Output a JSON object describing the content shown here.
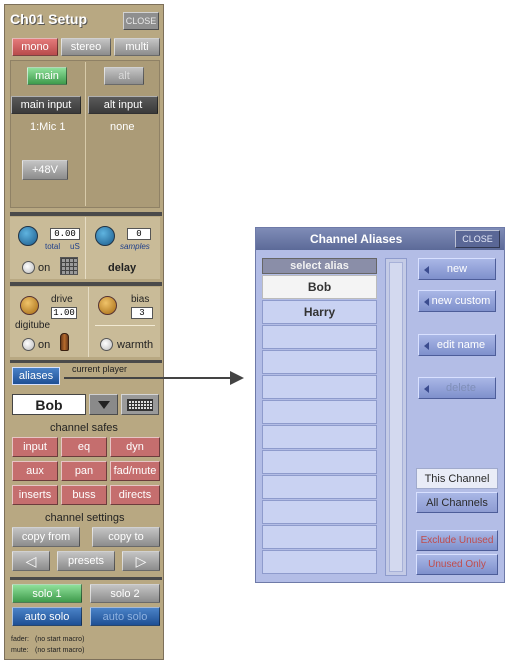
{
  "setup": {
    "title": "Ch01 Setup",
    "close": "CLOSE",
    "modes": [
      "mono",
      "stereo",
      "multi"
    ],
    "main_btn": "main",
    "alt_btn": "alt",
    "main_input_btn": "main input",
    "alt_input_btn": "alt input",
    "main_input_value": "1:Mic 1",
    "alt_input_value": "none",
    "phantom": "+48V",
    "delay": {
      "total_value": "0.00",
      "total_label": "total",
      "total_unit": "uS",
      "samples_value": "0",
      "samples_label": "samples",
      "on": "on",
      "title": "delay"
    },
    "digitube": {
      "drive_label": "drive",
      "drive_value": "1.00",
      "bias_label": "bias",
      "bias_value": "3",
      "name": "digitube",
      "on": "on",
      "warmth": "warmth"
    },
    "aliases_btn": "aliases",
    "current_player": "current player",
    "current_alias": "Bob",
    "safes_title": "channel safes",
    "safes": [
      "input",
      "eq",
      "dyn",
      "aux",
      "pan",
      "fad/mute",
      "inserts",
      "buss",
      "directs"
    ],
    "settings_title": "channel settings",
    "copy_from": "copy from",
    "copy_to": "copy to",
    "presets": "presets",
    "solo1": "solo 1",
    "solo2": "solo 2",
    "auto_solo1": "auto solo",
    "auto_solo2": "auto solo",
    "fader_label": "fader:",
    "fader_value": "(no start macro)",
    "mute_label": "mute:",
    "mute_value": "(no start macro)"
  },
  "aliases_panel": {
    "title": "Channel Aliases",
    "close": "CLOSE",
    "header": "select alias",
    "items": [
      "Bob",
      "Harry"
    ],
    "new": "new",
    "new_custom": "new custom",
    "edit_name": "edit name",
    "delete": "delete",
    "this_channel": "This Channel",
    "all_channels": "All Channels",
    "exclude_unused": "Exclude Unused",
    "unused_only": "Unused Only"
  },
  "colors": {
    "panel_bg": "#b8a882",
    "alias_bg": "#b3bde6",
    "accent_red": "#c56e6e",
    "accent_green": "#3f9b4c",
    "accent_blue": "#1e4f94"
  }
}
